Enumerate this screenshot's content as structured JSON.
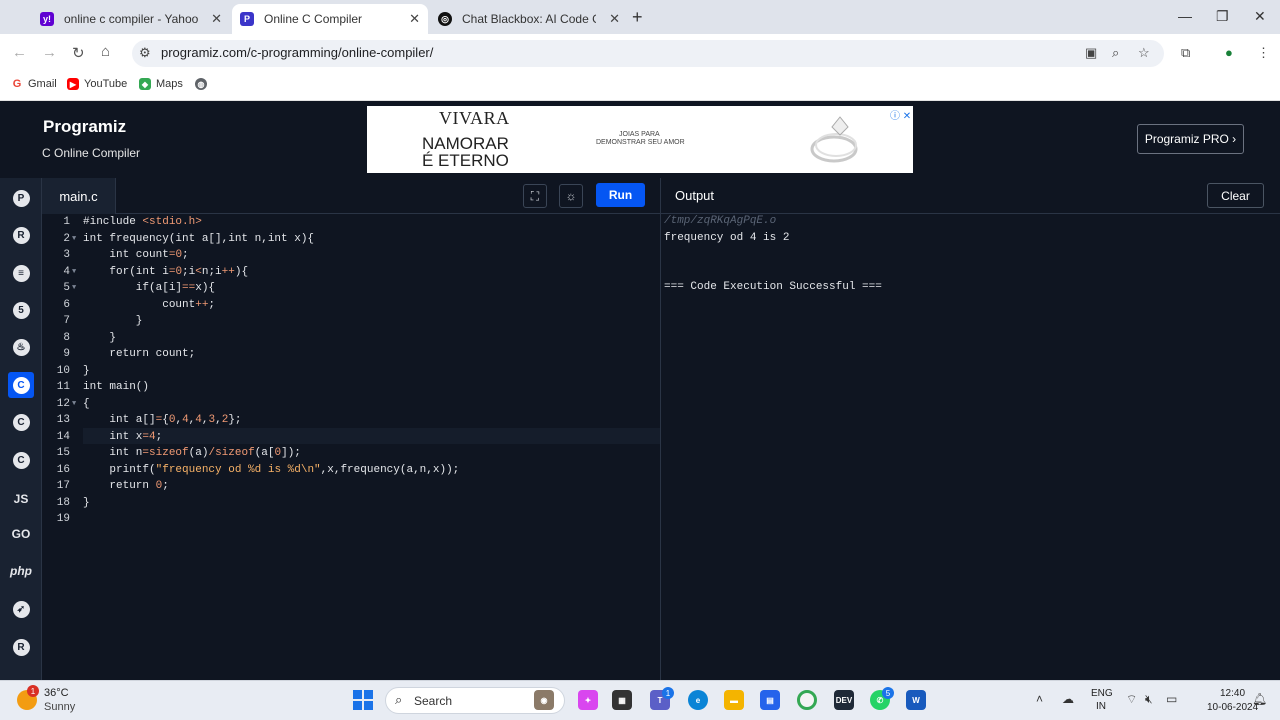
{
  "browser": {
    "tabs": [
      {
        "title": "online c compiler - Yahoo India",
        "icon": "yahoo-icon",
        "color": "#6001d2"
      },
      {
        "title": "Online C Compiler",
        "icon": "programiz-icon",
        "color": "#3b35c9"
      },
      {
        "title": "Chat Blackbox: AI Code Generat",
        "icon": "blackbox-icon",
        "color": "#111111"
      }
    ],
    "url": "programiz.com/c-programming/online-compiler/",
    "bookmarks": [
      "Gmail",
      "YouTube",
      "Maps"
    ]
  },
  "site": {
    "logo": "Programiz",
    "subtitle": "C Online Compiler",
    "pro_button": "Programiz PRO ›",
    "ad": {
      "brand": "VIVARA",
      "line1": "NAMORAR",
      "line2": "É ETERNO",
      "small1": "JOIAS PARA",
      "small2": "DEMONSTRAR SEU AMOR"
    }
  },
  "rail": [
    {
      "name": "python",
      "glyph": "P"
    },
    {
      "name": "r",
      "glyph": "R"
    },
    {
      "name": "sql",
      "glyph": "≡"
    },
    {
      "name": "html",
      "glyph": "5"
    },
    {
      "name": "java",
      "glyph": "♨"
    },
    {
      "name": "c",
      "glyph": "C",
      "selected": true
    },
    {
      "name": "cpp",
      "glyph": "C"
    },
    {
      "name": "csharp",
      "glyph": "C"
    },
    {
      "name": "javascript",
      "glyph": "JS"
    },
    {
      "name": "go",
      "glyph": "GO"
    },
    {
      "name": "php",
      "glyph": "php"
    },
    {
      "name": "swift",
      "glyph": "➶"
    },
    {
      "name": "rust",
      "glyph": "R"
    }
  ],
  "editor": {
    "file": "main.c",
    "run": "Run",
    "lines": [
      "#include <stdio.h>",
      "int frequency(int a[],int n,int x){",
      "    int count=0;",
      "    for(int i=0;i<n;i++){",
      "        if(a[i]==x){",
      "            count++;",
      "        }",
      "    }",
      "    return count;",
      "}",
      "int main()",
      "{",
      "    int a[]={0,4,4,3,2};",
      "    int x=4;",
      "    int n=sizeof(a)/sizeof(a[0]);",
      "    printf(\"frequency od %d is %d\\n\",x,frequency(a,n,x));",
      "    return 0;",
      "}",
      ""
    ],
    "foldable_lines": [
      2,
      4,
      5,
      12
    ],
    "active_line": 14
  },
  "output": {
    "title": "Output",
    "clear": "Clear",
    "tmp": "/tmp/zqRKqAgPqE.o",
    "result": "frequency od 4 is 2",
    "status": "=== Code Execution Successful ==="
  },
  "taskbar": {
    "temp": "36°C",
    "cond": "Sunny",
    "weather_badge": "1",
    "search": "Search",
    "lang1": "ENG",
    "lang2": "IN",
    "time": "12:40",
    "date": "10-06-2024",
    "teams_badge": "1",
    "whatsapp_badge": "5"
  }
}
